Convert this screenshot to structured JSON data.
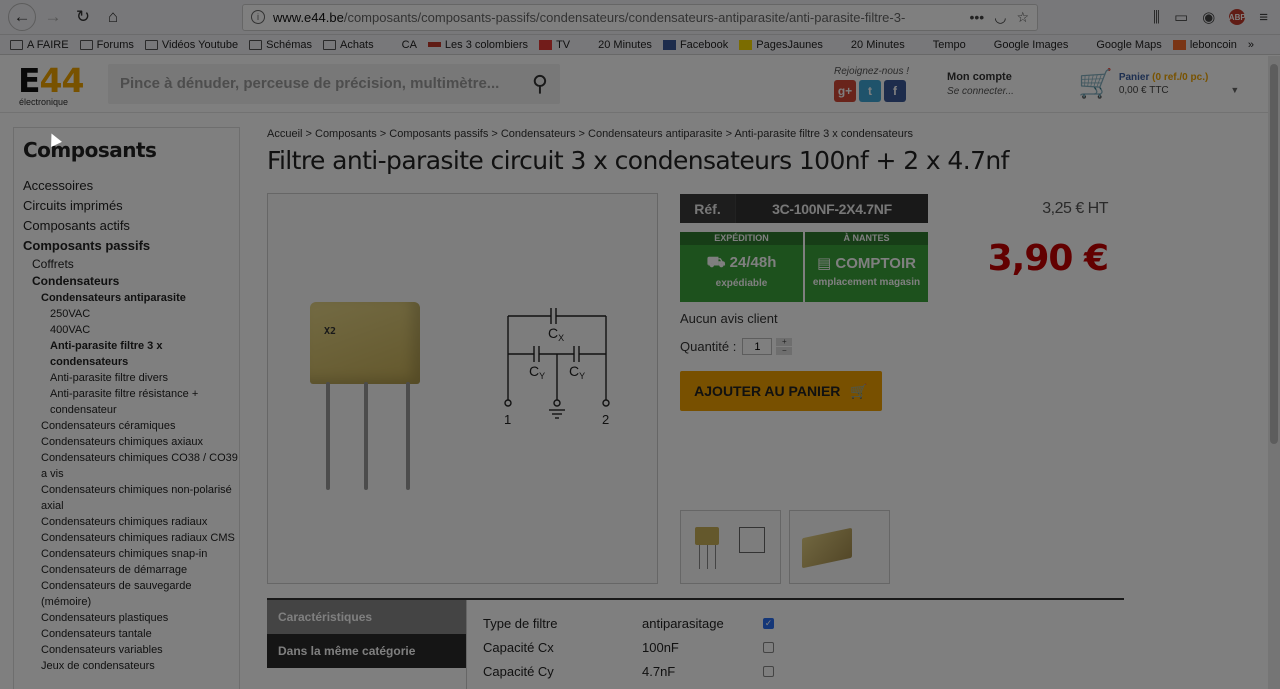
{
  "browser": {
    "url_host": "www.e44.be",
    "url_path": "/composants/composants-passifs/condensateurs/condensateurs-antiparasite/anti-parasite-filtre-3-",
    "bookmarks": [
      "A FAIRE",
      "Forums",
      "Vidéos Youtube",
      "Schémas",
      "Achats",
      "CA",
      "Les 3 colombiers",
      "TV",
      "20 Minutes",
      "Facebook",
      "PagesJaunes",
      "20 Minutes",
      "Tempo",
      "Google Images",
      "Google Maps",
      "leboncoin"
    ]
  },
  "header": {
    "logo_main": "E",
    "logo_accent": "44",
    "logo_sub": "électronique",
    "search_placeholder": "Pince à dénuder, perceuse de précision, multimètre...",
    "social_label": "Rejoignez-nous !",
    "account_title": "Mon compte",
    "account_sub": "Se connecter...",
    "cart_title": "Panier",
    "cart_count": "(0 ref./0 pc.)",
    "cart_total": "0,00 € TTC"
  },
  "sidebar": {
    "title": "Composants",
    "items": [
      {
        "label": "Accessoires",
        "level": 1,
        "bold": false
      },
      {
        "label": "Circuits imprimés",
        "level": 1,
        "bold": false
      },
      {
        "label": "Composants actifs",
        "level": 1,
        "bold": false
      },
      {
        "label": "Composants passifs",
        "level": 1,
        "bold": true
      },
      {
        "label": "Coffrets",
        "level": 2,
        "bold": false
      },
      {
        "label": "Condensateurs",
        "level": 2,
        "bold": true
      },
      {
        "label": "Condensateurs antiparasite",
        "level": 3,
        "bold": true
      },
      {
        "label": "250VAC",
        "level": 4,
        "bold": false
      },
      {
        "label": "400VAC",
        "level": 4,
        "bold": false
      },
      {
        "label": "Anti-parasite filtre 3 x condensateurs",
        "level": 4,
        "bold": true
      },
      {
        "label": "Anti-parasite filtre divers",
        "level": 4,
        "bold": false
      },
      {
        "label": "Anti-parasite filtre résistance + condensateur",
        "level": 4,
        "bold": false
      },
      {
        "label": "Condensateurs céramiques",
        "level": 3,
        "bold": false
      },
      {
        "label": "Condensateurs chimiques axiaux",
        "level": 3,
        "bold": false
      },
      {
        "label": "Condensateurs chimiques CO38 / CO39 a vis",
        "level": 3,
        "bold": false
      },
      {
        "label": "Condensateurs chimiques non-polarisé axial",
        "level": 3,
        "bold": false
      },
      {
        "label": "Condensateurs chimiques radiaux",
        "level": 3,
        "bold": false
      },
      {
        "label": "Condensateurs chimiques radiaux CMS",
        "level": 3,
        "bold": false
      },
      {
        "label": "Condensateurs chimiques snap-in",
        "level": 3,
        "bold": false
      },
      {
        "label": "Condensateurs de démarrage",
        "level": 3,
        "bold": false
      },
      {
        "label": "Condensateurs de sauvegarde (mémoire)",
        "level": 3,
        "bold": false
      },
      {
        "label": "Condensateurs plastiques",
        "level": 3,
        "bold": false
      },
      {
        "label": "Condensateurs tantale",
        "level": 3,
        "bold": false
      },
      {
        "label": "Condensateurs variables",
        "level": 3,
        "bold": false
      },
      {
        "label": "Jeux de condensateurs",
        "level": 3,
        "bold": false
      }
    ]
  },
  "product": {
    "breadcrumb": "Accueil > Composants > Composants passifs > Condensateurs > Condensateurs antiparasite > Anti-parasite filtre 3 x condensateurs",
    "title": "Filtre anti-parasite circuit 3 x condensateurs 100nf + 2 x 4.7nf",
    "image_label": "X2",
    "ref_label": "Réf.",
    "ref_value": "3C-100NF-2X4.7NF",
    "price_ht": "3,25 € HT",
    "price_ttc": "3,90 €",
    "badge1_head": "EXPÉDITION",
    "badge1_main": "24/48h",
    "badge1_sub": "expédiable",
    "badge2_head": "À NANTES",
    "badge2_main": "COMPTOIR",
    "badge2_sub": "emplacement magasin",
    "reviews": "Aucun avis client",
    "qty_label": "Quantité :",
    "qty_value": "1",
    "add_cart": "AJOUTER AU PANIER",
    "schematic": {
      "cx": "C",
      "cx_sub": "X",
      "cy": "C",
      "cy_sub": "Y",
      "pin1": "1",
      "pin2": "2"
    }
  },
  "tabs": {
    "characteristics": "Caractéristiques",
    "same_category": "Dans la même catégorie"
  },
  "specs": [
    {
      "key": "Type de filtre",
      "value": "antiparasitage",
      "checked": true
    },
    {
      "key": "Capacité Cx",
      "value": "100nF",
      "checked": false
    },
    {
      "key": "Capacité Cy",
      "value": "4.7nF",
      "checked": false
    }
  ],
  "colors": {
    "accent": "#f0a500",
    "price": "#c40000",
    "badge_green": "#3aa33a"
  }
}
